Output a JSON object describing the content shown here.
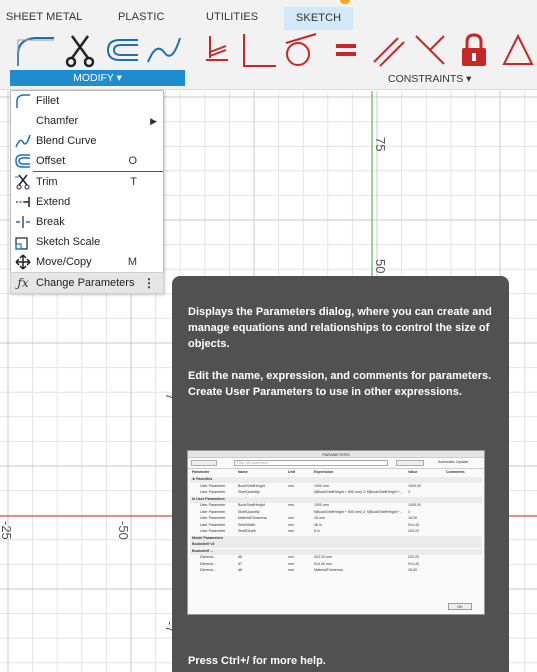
{
  "tabs": [
    {
      "label": "SHEET METAL"
    },
    {
      "label": "PLASTIC"
    },
    {
      "label": "UTILITIES"
    },
    {
      "label": "SKETCH",
      "active": true
    }
  ],
  "ribbon": {
    "modify_label": "MODIFY ▾",
    "constraints_label": "CONSTRAINTS ▾",
    "modify_icons": [
      "fillet-icon",
      "trim-icon",
      "offset-icon",
      "blend-curve-icon"
    ],
    "constraint_icons": [
      "coincident-icon",
      "perpendicular-icon",
      "tangent-icon",
      "equal-icon",
      "parallel-icon",
      "collinear-icon",
      "fix-icon",
      "triangle-icon"
    ],
    "accent": "#1f8ccf"
  },
  "menu": {
    "items": [
      {
        "label": "Fillet",
        "icon": "fillet-icon"
      },
      {
        "label": "Chamfer",
        "icon": "",
        "submenu": true
      },
      {
        "label": "Blend Curve",
        "icon": "blend-curve-icon"
      },
      {
        "label": "Offset",
        "icon": "offset-icon",
        "shortcut": "O"
      },
      {
        "label": "Trim",
        "icon": "trim-icon",
        "shortcut": "T"
      },
      {
        "label": "Extend",
        "icon": "extend-icon"
      },
      {
        "label": "Break",
        "icon": "break-icon"
      },
      {
        "label": "Sketch Scale",
        "icon": "sketch-scale-icon"
      },
      {
        "label": "Move/Copy",
        "icon": "move-icon",
        "shortcut": "M"
      },
      {
        "label": "Change Parameters",
        "icon": "fx-icon",
        "highlighted": true
      }
    ]
  },
  "canvas": {
    "labels": [
      "75",
      "50",
      "7",
      "-25",
      "-50",
      "-7"
    ]
  },
  "tooltip": {
    "para1": "Displays the Parameters dialog, where you can create and manage equations and relationships to control the size of objects.",
    "para2": "Edit the name, expression, and comments for parameters. Create User Parameters to use in other expressions.",
    "footer": "Press Ctrl+/ for more help.",
    "thumb": {
      "title": "PARAMETERS",
      "filter_placeholder": "Filter all parameters",
      "auto_update": "Automatic Update",
      "headers": [
        "Parameter",
        "Name",
        "Unit",
        "Expression",
        "Value",
        "Comments"
      ],
      "rows": [
        [
          "★ Favorites",
          "",
          "",
          "",
          "",
          ""
        ],
        [
          "User Parameter",
          "BookShelfHeight",
          "mm",
          "1000 mm",
          "1000.00",
          ""
        ],
        [
          "User Parameter",
          "ShelfQuantity",
          "",
          "fl(BookShelfHeight + 500 mm) 2; fl(BookShelfHeight +...",
          "3",
          ""
        ],
        [
          "fx User Parameters",
          "",
          "",
          "",
          "",
          ""
        ],
        [
          "User Parameter",
          "BookShelfHeight",
          "mm",
          "1000 mm",
          "1000.00",
          ""
        ],
        [
          "User Parameter",
          "ShelfQuantity",
          "",
          "fl(BookShelfHeight + 500 mm) 2; fl(BookShelfHeight +...",
          "3",
          ""
        ],
        [
          "User Parameter",
          "MaterialThickness",
          "mm",
          "18 mm",
          "18.00",
          ""
        ],
        [
          "User Parameter",
          "ShelfWidth",
          "mm",
          "36 in",
          "914.40",
          ""
        ],
        [
          "User Parameter",
          "ShelfDepth",
          "mm",
          "8 in",
          "203.20",
          ""
        ],
        [
          "Model Parameters",
          "",
          "",
          "",
          "",
          ""
        ],
        [
          "Bookshelf v3",
          "",
          "",
          "",
          "",
          ""
        ],
        [
          "Bookshelf ...",
          "",
          "",
          "",
          "",
          ""
        ],
        [
          "Dimensi...",
          "d6",
          "mm",
          "203.20 mm",
          "203.20",
          ""
        ],
        [
          "Dimensi...",
          "d7",
          "mm",
          "914.40 mm",
          "914.40",
          ""
        ],
        [
          "Dimensi...",
          "d8",
          "mm",
          "MaterialThickness",
          "18.00",
          ""
        ]
      ],
      "ok_label": "OK"
    }
  }
}
